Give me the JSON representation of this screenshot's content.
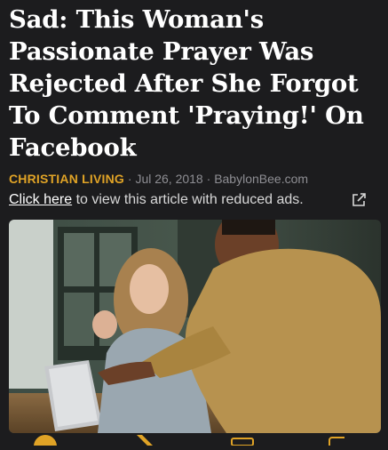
{
  "article": {
    "title": "Sad: This Woman's Passionate Prayer Was Rejected After She Forgot To Comment 'Praying!' On Facebook",
    "category": "CHRISTIAN LIVING",
    "separator": "·",
    "date": "Jul 26, 2018",
    "source": "BabylonBee.com"
  },
  "reduced_ads": {
    "link_text": "Click here",
    "rest_text": " to view this article with reduced ads."
  },
  "photo": {
    "description_icon": "stock-photo-man-woman-laptop"
  },
  "share_icons": [
    "facebook-icon",
    "x-icon",
    "email-icon",
    "share-icon"
  ],
  "colors": {
    "background": "#1c1c1e",
    "category": "#e0a326",
    "meta": "#8e8e93"
  }
}
